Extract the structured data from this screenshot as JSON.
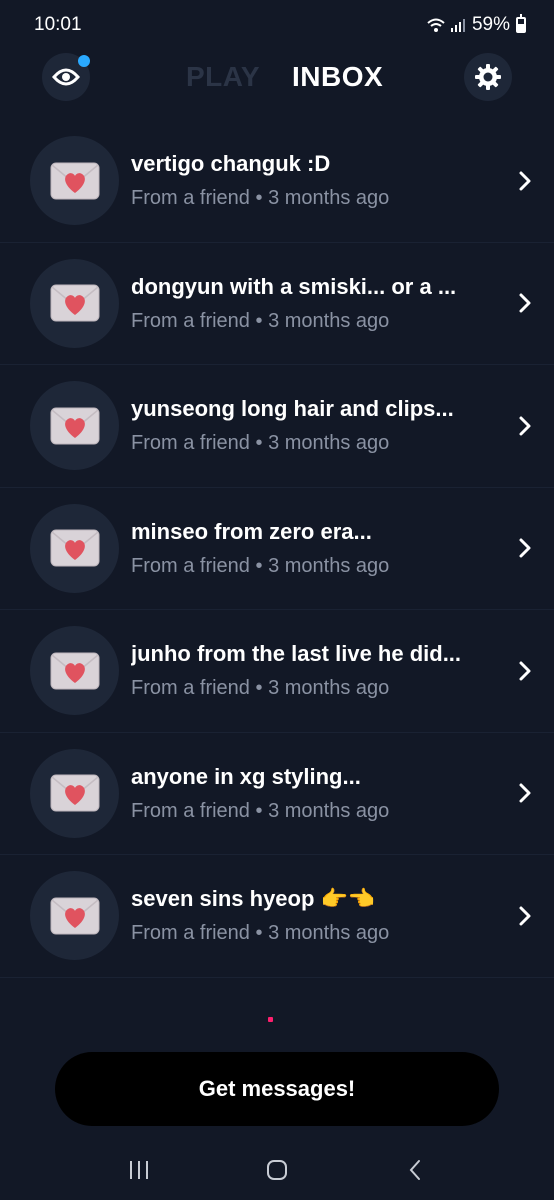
{
  "status_bar": {
    "time": "10:01",
    "battery": "59%",
    "icons": [
      "wifi-icon",
      "signal-icon",
      "battery-icon"
    ]
  },
  "header": {
    "tabs": [
      {
        "label": "PLAY",
        "active": false
      },
      {
        "label": "INBOX",
        "active": true
      }
    ],
    "left_icon": "eye-icon",
    "right_icon": "gear-icon",
    "notification_dot_color": "#2aa9ff"
  },
  "messages": [
    {
      "title": "vertigo changuk :D",
      "sender": "From a friend",
      "time": "3 months ago"
    },
    {
      "title": "dongyun with a smiski... or a ...",
      "sender": "From a friend",
      "time": "3 months ago"
    },
    {
      "title": "yunseong long hair and clips...",
      "sender": "From a friend",
      "time": "3 months ago"
    },
    {
      "title": "minseo from zero era...",
      "sender": "From a friend",
      "time": "3 months ago"
    },
    {
      "title": "junho from the last live he did...",
      "sender": "From a friend",
      "time": "3 months ago"
    },
    {
      "title": "anyone in xg styling...",
      "sender": "From a friend",
      "time": "3 months ago"
    },
    {
      "title": "seven sins hyeop 👉👈",
      "sender": "From a friend",
      "time": "3 months ago"
    }
  ],
  "meta_separator": " • ",
  "cta": {
    "label": "Get messages!"
  },
  "colors": {
    "background": "#121826",
    "circle": "#1e2738",
    "heart": "#e0535f",
    "envelope": "#d9d3d8",
    "muted_text": "#8a92a3",
    "accent_dot": "#ff1f6e"
  },
  "nav_bar": {
    "icons": [
      "recent-apps-icon",
      "home-icon",
      "back-icon"
    ]
  }
}
